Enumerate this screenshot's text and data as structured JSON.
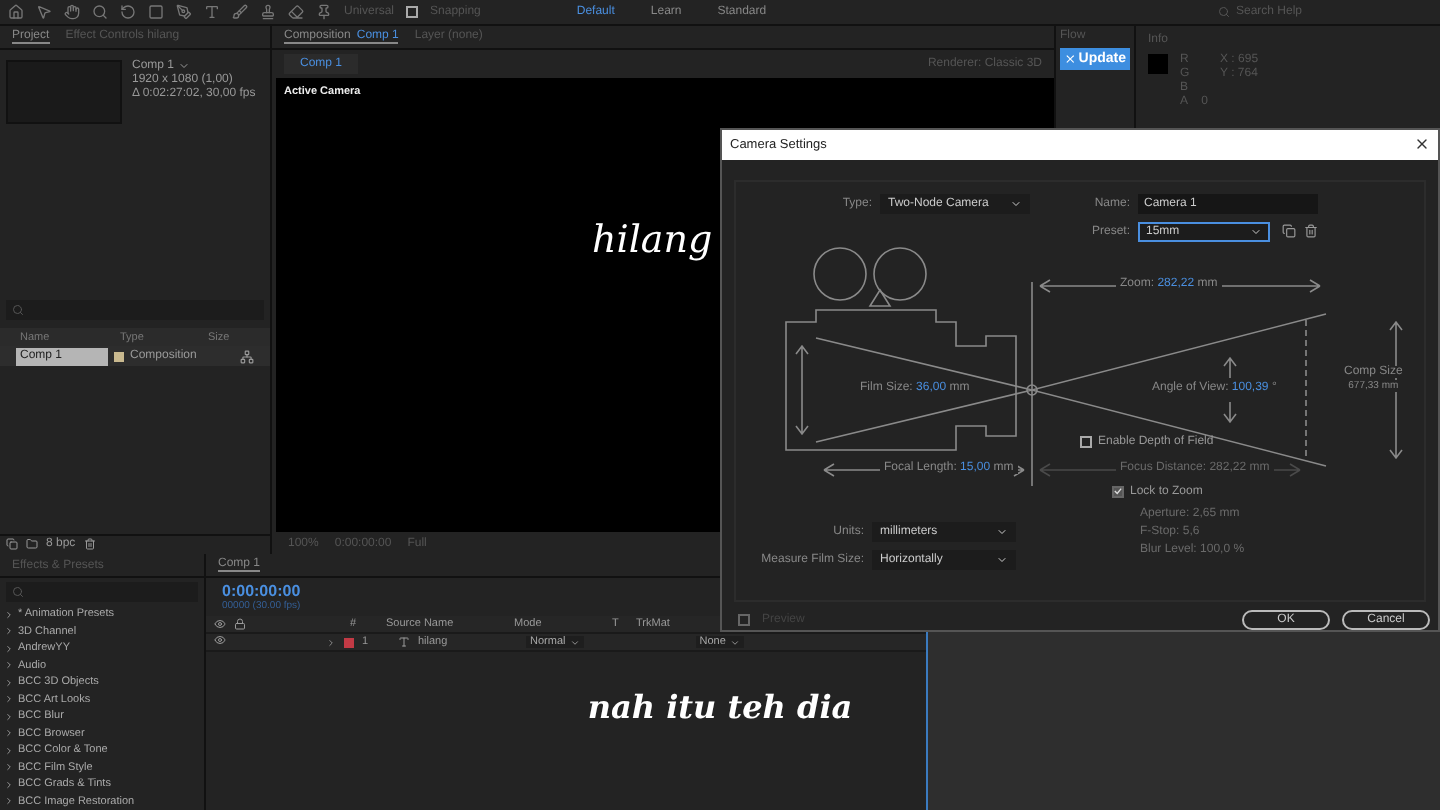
{
  "toolbar": {
    "universal": "Universal",
    "snapping": {
      "label": "Snapping",
      "checked": false
    },
    "workspaces": [
      {
        "label": "Default",
        "selected": true
      },
      {
        "label": "Learn",
        "selected": false
      },
      {
        "label": "Standard",
        "selected": false
      }
    ],
    "search": {
      "placeholder": "Search Help"
    }
  },
  "project_panel": {
    "tabs": [
      {
        "label": "Project",
        "selected": true
      },
      {
        "label": "Effect Controls hilang",
        "selected": false
      }
    ],
    "comp_name": "Comp 1",
    "comp_size": "1920 x 1080 (1,00)",
    "comp_duration": "Δ 0:02:27:02, 30,00 fps",
    "columns": [
      "Name",
      "Type",
      "Size"
    ],
    "rows": [
      {
        "name": "Comp 1",
        "type": "Composition",
        "selected": true
      }
    ],
    "bit_depth": "8 bpc"
  },
  "composition_panel": {
    "tab": {
      "label": "Composition",
      "name": "Comp 1",
      "selected": true
    },
    "layer_tab": {
      "label": "Layer (none)",
      "selected": false
    },
    "sub_tab": "Comp 1",
    "renderer": {
      "label": "Renderer:",
      "value": "Classic 3D"
    },
    "camera_label": "Active Camera",
    "text": "hilang",
    "footer": {
      "zoom": "100%",
      "time": "0:00:00:00",
      "resolution": "Full"
    }
  },
  "flow_panel": {
    "title": "Flow",
    "button": "Update"
  },
  "info_panel": {
    "title": "Info",
    "channels": [
      "R",
      "G",
      "B",
      "A"
    ],
    "alpha": "0",
    "x": "X : 695",
    "y": "Y : 764"
  },
  "effects_panel": {
    "title": "Effects & Presets",
    "items": [
      "* Animation Presets",
      "3D Channel",
      "AndrewYY",
      "Audio",
      "BCC 3D Objects",
      "BCC Art Looks",
      "BCC Blur",
      "BCC Browser",
      "BCC Color & Tone",
      "BCC Film Style",
      "BCC Grads & Tints",
      "BCC Image Restoration"
    ]
  },
  "timeline": {
    "tab": "Comp 1",
    "timecode": "0:00:00:00",
    "frame": "00000 (30.00 fps)",
    "columns": [
      "#",
      "Source Name",
      "Mode",
      "T",
      "TrkMat"
    ],
    "layers": [
      {
        "number": "1",
        "name": "hilang",
        "mode": "Normal",
        "parent": "None",
        "color": "#c23a45",
        "visible": true
      }
    ]
  },
  "dialog": {
    "title": "Camera Settings",
    "type": {
      "label": "Type:",
      "value": "Two-Node Camera"
    },
    "name": {
      "label": "Name:",
      "value": "Camera 1"
    },
    "preset": {
      "label": "Preset:",
      "value": "15mm"
    },
    "zoom": {
      "label": "Zoom:",
      "value": "282,22",
      "unit": "mm"
    },
    "film_size": {
      "label": "Film Size:",
      "value": "36,00",
      "unit": "mm"
    },
    "angle_of_view": {
      "label": "Angle of View:",
      "value": "100,39",
      "unit": "°"
    },
    "comp_size": {
      "label": "Comp Size",
      "value": "677,33 mm"
    },
    "enable_dof": {
      "label": "Enable Depth of Field",
      "checked": false
    },
    "focal_length": {
      "label": "Focal Length:",
      "value": "15,00",
      "unit": "mm",
      "disabled": false
    },
    "focus_distance": {
      "label": "Focus Distance:",
      "value": "282,22",
      "unit": "mm",
      "disabled": true
    },
    "lock_to_zoom": {
      "label": "Lock to Zoom",
      "checked": true
    },
    "units": {
      "label": "Units:",
      "value": "millimeters"
    },
    "measure": {
      "label": "Measure Film Size:",
      "value": "Horizontally"
    },
    "aperture": {
      "label": "Aperture:",
      "value": "2,65",
      "unit": "mm",
      "disabled": true
    },
    "f_stop": {
      "label": "F-Stop:",
      "value": "5,6",
      "disabled": true
    },
    "blur": {
      "label": "Blur Level:",
      "value": "100,0",
      "unit": "%",
      "disabled": true
    },
    "preview": {
      "label": "Preview",
      "checked": false
    },
    "buttons": [
      "OK",
      "Cancel"
    ]
  },
  "caption": "nah itu teh dia"
}
